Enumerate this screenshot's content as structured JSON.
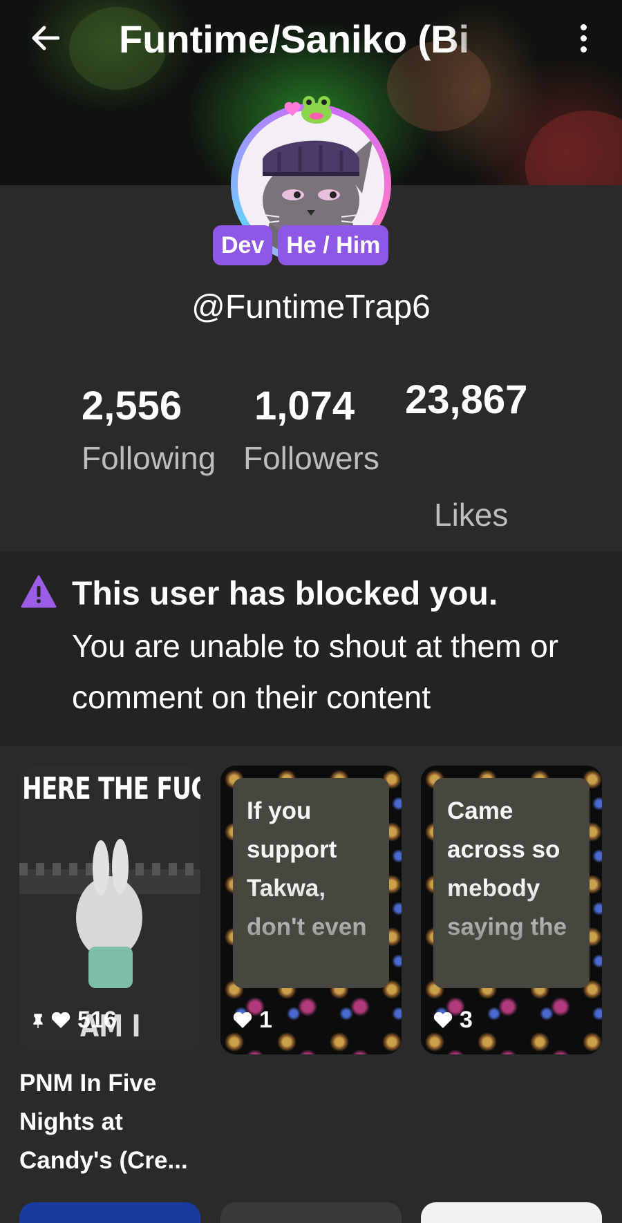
{
  "header": {
    "title": "Funtime/Saniko (Bi"
  },
  "profile": {
    "badges": [
      "Dev",
      "He / Him"
    ],
    "username": "@FuntimeTrap6"
  },
  "stats": [
    {
      "value": "2,556",
      "label": "Following"
    },
    {
      "value": "1,074",
      "label": "Followers"
    },
    {
      "value": "23,867",
      "label": "Likes"
    }
  ],
  "notice": {
    "title": "This user has blocked you.",
    "body": "You are unable to shout at them or comment on their content"
  },
  "posts": [
    {
      "overlay_top": "HERE THE FUC",
      "overlay_bottom": "AM I",
      "likes": "516",
      "pinned": true,
      "caption": "PNM In Five Nights at Candy's (Cre..."
    },
    {
      "text": "If you support Takwa, don't even",
      "likes": "1"
    },
    {
      "text": "Came across so mebody saying the",
      "likes": "3"
    }
  ],
  "colors": {
    "background": "#2a2a2a",
    "badge": "#8f57e6",
    "notice_bg": "#232323",
    "text_card": "#48473f"
  }
}
